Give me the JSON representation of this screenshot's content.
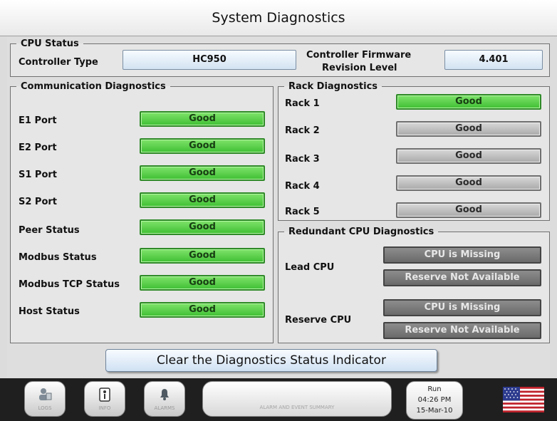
{
  "title": "System Diagnostics",
  "cpu_status": {
    "legend": "CPU Status",
    "controller_type_label": "Controller Type",
    "controller_type_value": "HC950",
    "firmware_label_line1": "Controller Firmware",
    "firmware_label_line2": "Revision Level",
    "firmware_value": "4.401"
  },
  "comm": {
    "legend": "Communication Diagnostics",
    "items": [
      {
        "label": "E1 Port",
        "status": "Good"
      },
      {
        "label": "E2 Port",
        "status": "Good"
      },
      {
        "label": "S1 Port",
        "status": "Good"
      },
      {
        "label": "S2 Port",
        "status": "Good"
      },
      {
        "label": "Peer Status",
        "status": "Good"
      },
      {
        "label": "Modbus Status",
        "status": "Good"
      },
      {
        "label": "Modbus TCP Status",
        "status": "Good"
      },
      {
        "label": "Host Status",
        "status": "Good"
      }
    ]
  },
  "rack": {
    "legend": "Rack Diagnostics",
    "items": [
      {
        "label": "Rack 1",
        "status": "Good",
        "color": "#3fbf33"
      },
      {
        "label": "Rack 2",
        "status": "Good",
        "color": "#a9a9a9"
      },
      {
        "label": "Rack 3",
        "status": "Good",
        "color": "#a9a9a9"
      },
      {
        "label": "Rack 4",
        "status": "Good",
        "color": "#a9a9a9"
      },
      {
        "label": "Rack 5",
        "status": "Good",
        "color": "#a9a9a9"
      }
    ]
  },
  "redundant": {
    "legend": "Redundant CPU Diagnostics",
    "lead_label": "Lead CPU",
    "lead_status1": "CPU is Missing",
    "lead_status2": "Reserve Not Available",
    "reserve_label": "Reserve CPU",
    "reserve_status1": "CPU is Missing",
    "reserve_status2": "Reserve Not Available"
  },
  "clear_button": "Clear the Diagnostics Status Indicator",
  "bottom": {
    "nav": [
      {
        "label": "LOGS",
        "icon": "user-log-icon"
      },
      {
        "label": "INFO",
        "icon": "info-icon"
      },
      {
        "label": "ALARMS",
        "icon": "alarm-bell-icon"
      }
    ],
    "summary": "ALARM AND EVENT SUMMARY",
    "mode": "Run",
    "time": "04:26 PM",
    "date": "15-Mar-10"
  }
}
